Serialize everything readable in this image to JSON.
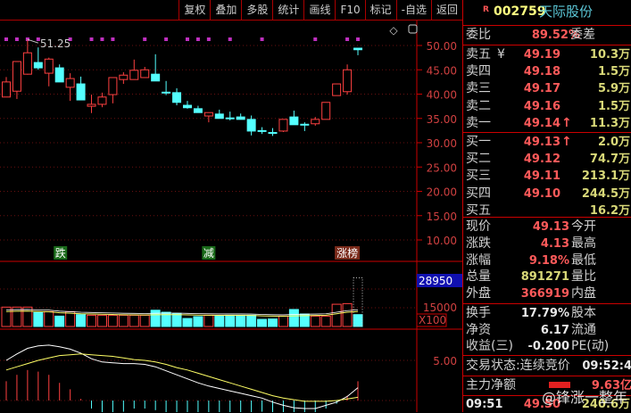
{
  "toolbar": [
    "复权",
    "叠加",
    "多股",
    "统计",
    "画线",
    "F10",
    "标记",
    "-自选",
    "返回"
  ],
  "stock": {
    "badge": "R",
    "code": "002759",
    "name": "天际股份"
  },
  "weibi": {
    "label": "委比",
    "value": "89.52%",
    "label2": "委差"
  },
  "sell": [
    {
      "label": "卖五",
      "extra": "¥",
      "price": "49.19",
      "vol": "10.3万"
    },
    {
      "label": "卖四",
      "price": "49.18",
      "vol": "1.5万"
    },
    {
      "label": "卖三",
      "price": "49.17",
      "vol": "5.9万"
    },
    {
      "label": "卖二",
      "price": "49.16",
      "vol": "1.5万"
    },
    {
      "label": "卖一",
      "price": "49.14",
      "arrow": "↑",
      "vol": "11.3万"
    }
  ],
  "buy": [
    {
      "label": "买一",
      "price": "49.13",
      "arrow": "↑",
      "vol": "2.0万"
    },
    {
      "label": "买二",
      "price": "49.12",
      "vol": "74.7万"
    },
    {
      "label": "买三",
      "price": "49.11",
      "vol": "213.1万"
    },
    {
      "label": "买四",
      "price": "49.10",
      "vol": "244.5万"
    },
    {
      "label": "买五",
      "price": "",
      "vol": "16.2万"
    }
  ],
  "quote": [
    {
      "label": "现价",
      "value": "49.13",
      "color": "red",
      "label2": "今开"
    },
    {
      "label": "涨跌",
      "value": "4.13",
      "color": "red",
      "label2": "最高"
    },
    {
      "label": "涨幅",
      "value": "9.18%",
      "color": "red",
      "label2": "最低"
    },
    {
      "label": "总量",
      "value": "891271",
      "color": "yel",
      "label2": "量比"
    },
    {
      "label": "外盘",
      "value": "366919",
      "color": "red",
      "label2": "内盘"
    }
  ],
  "fund": [
    {
      "label": "换手",
      "value": "17.79%",
      "label2": "股本"
    },
    {
      "label": "净资",
      "value": "6.17",
      "label2": "流通"
    },
    {
      "label": "收益(三)",
      "value": "-0.200",
      "label2": "PE(动)"
    }
  ],
  "status": {
    "label": "交易状态:连续竞价",
    "time": "09:52:4"
  },
  "mainfund": {
    "label": "主力净额",
    "value": "9.63亿"
  },
  "tick": {
    "time": "09:51",
    "price": "49.50",
    "vol": "240.6万"
  },
  "watermark": "@锋涨一整年",
  "axis": {
    "price": [
      "50.00",
      "45.00",
      "40.00",
      "35.00",
      "30.00",
      "25.00",
      "20.00",
      "15.00",
      "10.00"
    ],
    "vol_cursor": "28950",
    "vol_tick": "15000",
    "vol_unit": "X100",
    "macd_tick": "5.00"
  },
  "high_label": "51.25",
  "signals": [
    {
      "i": 5,
      "text": "跌",
      "color": "#1a6a1a"
    },
    {
      "i": 19,
      "text": "减",
      "color": "#1a6a1a"
    },
    {
      "i": 32,
      "text": "涨榜",
      "color": "#7a2a1a"
    }
  ],
  "colors": {
    "up": "#ff4040",
    "down": "#54ffff",
    "dif": "#ffffff",
    "dea": "#ffff66",
    "dot": "#c030c0"
  },
  "chart_data": {
    "type": "candlestick",
    "ohlc": [
      [
        39.4,
        43.5,
        39.4,
        42.5
      ],
      [
        40.6,
        46.7,
        39,
        46.7
      ],
      [
        44.1,
        51.25,
        44,
        48.5
      ],
      [
        46.5,
        49.6,
        45,
        45.4
      ],
      [
        44.3,
        47.5,
        41.6,
        47.2
      ],
      [
        45.4,
        46.1,
        42.5,
        42.5
      ],
      [
        41.4,
        44.3,
        38.6,
        43.2
      ],
      [
        42.1,
        43.6,
        38.8,
        38.8
      ],
      [
        37.5,
        39.9,
        36.1,
        37.9
      ],
      [
        37.9,
        40.3,
        37.3,
        39.4
      ],
      [
        39.9,
        43.4,
        38.1,
        43.4
      ],
      [
        43,
        44.5,
        42.1,
        43.9
      ],
      [
        43,
        47.1,
        43,
        44.9
      ],
      [
        43.4,
        45.6,
        43.4,
        45
      ],
      [
        44.1,
        48.2,
        42.7,
        42.7
      ],
      [
        40.4,
        42.7,
        39.8,
        40.3
      ],
      [
        40.3,
        41.2,
        37.7,
        38.3
      ],
      [
        37.7,
        38.6,
        37,
        37.2
      ],
      [
        37,
        37.6,
        36.2,
        36.2
      ],
      [
        35.5,
        36.2,
        34.2,
        36.2
      ],
      [
        35.9,
        36.8,
        35,
        35
      ],
      [
        35.1,
        36.4,
        34.6,
        35
      ],
      [
        35.3,
        36,
        34.8,
        34.8
      ],
      [
        34.8,
        35.6,
        31.5,
        32.4
      ],
      [
        32.5,
        33.2,
        31.8,
        32.4
      ],
      [
        32.1,
        33,
        31.4,
        32
      ],
      [
        32.4,
        34.8,
        32.2,
        34.8
      ],
      [
        35.3,
        36.6,
        33.7,
        33.7
      ],
      [
        33.8,
        34.2,
        32.4,
        33.7
      ],
      [
        33.9,
        35.3,
        33.5,
        34.8
      ],
      [
        34.8,
        38.3,
        34.8,
        38.3
      ],
      [
        39.7,
        42.1,
        39.7,
        42.1
      ],
      [
        40.5,
        46.1,
        39.9,
        45
      ],
      [
        49.45,
        49.5,
        48,
        49.13
      ]
    ],
    "volume": [
      15500,
      15500,
      15500,
      11200,
      11900,
      8300,
      11900,
      9500,
      9000,
      9000,
      9000,
      9000,
      9000,
      9000,
      13000,
      11400,
      10500,
      6400,
      7900,
      9000,
      8300,
      9000,
      9000,
      9000,
      5700,
      6000,
      8300,
      13600,
      10000,
      8300,
      8300,
      17800,
      18300,
      9500
    ],
    "volume_outline_last": 39000,
    "vol_ma": [
      12000,
      12200,
      12300,
      12000,
      11800,
      11000,
      10600,
      10200,
      10000,
      9800,
      9600,
      9400,
      9300,
      9200,
      9400,
      9500,
      9500,
      9300,
      9100,
      9000,
      8900,
      8900,
      8900,
      8800,
      8500,
      8300,
      8200,
      8500,
      8700,
      8800,
      9000,
      10200,
      11400,
      12000
    ],
    "dif": [
      5.0,
      5.8,
      6.5,
      6.8,
      6.9,
      6.7,
      6.4,
      5.9,
      5.2,
      4.8,
      4.7,
      4.6,
      4.6,
      4.5,
      4.2,
      3.7,
      3.2,
      2.7,
      2.2,
      1.8,
      1.5,
      1.2,
      0.9,
      0.6,
      0.3,
      -0.2,
      -0.6,
      -0.9,
      -1.0,
      -1.0,
      -0.6,
      -0.2,
      0.5,
      1.6
    ],
    "dea": [
      3.8,
      4.2,
      4.6,
      5.0,
      5.3,
      5.6,
      5.7,
      5.8,
      5.7,
      5.6,
      5.5,
      5.3,
      5.1,
      5.0,
      4.8,
      4.5,
      4.1,
      3.8,
      3.4,
      3.0,
      2.6,
      2.2,
      1.8,
      1.4,
      1.0,
      0.6,
      0.3,
      0.1,
      -0.1,
      -0.1,
      -0.1,
      0.0,
      0.2,
      0.4
    ],
    "dots": [
      0,
      1,
      2,
      3,
      6,
      8,
      9,
      10,
      13,
      15,
      17,
      18,
      19,
      21,
      24,
      29,
      32,
      33
    ],
    "ylim": [
      10,
      50
    ]
  }
}
